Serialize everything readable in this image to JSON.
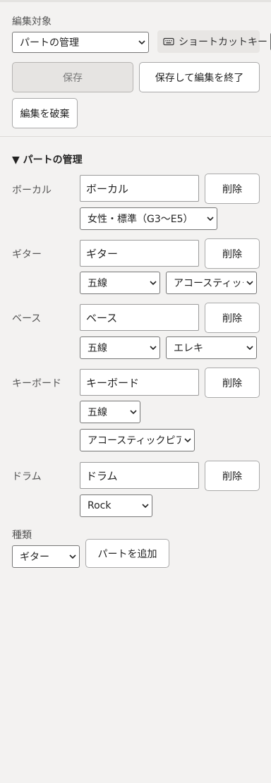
{
  "edit_target": {
    "label": "編集対象",
    "selected": "パートの管理",
    "shortcut_label": "ショートカットキー",
    "help": "?"
  },
  "actions": {
    "save": "保存",
    "save_and_finish": "保存して編集を終了",
    "discard": "編集を破棄"
  },
  "parts_section": {
    "title": "▼ パートの管理",
    "delete_label": "削除",
    "parts": [
      {
        "label": "ボーカル",
        "name": "ボーカル",
        "range": "女性・標準（G3〜E5）"
      },
      {
        "label": "ギター",
        "name": "ギター",
        "notation": "五線",
        "type": "アコースティック"
      },
      {
        "label": "ベース",
        "name": "ベース",
        "notation": "五線",
        "type": "エレキ"
      },
      {
        "label": "キーボード",
        "name": "キーボード",
        "notation": "五線",
        "type": "アコースティックピアノ"
      },
      {
        "label": "ドラム",
        "name": "ドラム",
        "style": "Rock"
      }
    ]
  },
  "add_part": {
    "type_label": "種類",
    "type_selected": "ギター",
    "add_button": "パートを追加"
  }
}
